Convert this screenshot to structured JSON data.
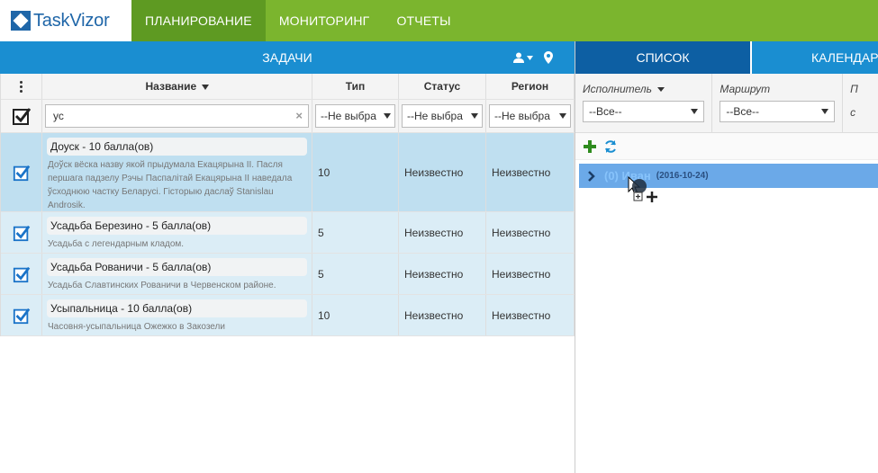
{
  "app": {
    "logo_text": "TaskVizor",
    "nav": [
      "ПЛАНИРОВАНИЕ",
      "МОНИТОРИНГ",
      "ОТЧЕТЫ"
    ],
    "active_nav": 0
  },
  "tasks_panel": {
    "title": "ЗАДАЧИ",
    "columns": [
      "Название",
      "Тип",
      "Статус",
      "Регион"
    ],
    "filter": {
      "name_value": "ус",
      "clear_symbol": "×",
      "type_select": "--Не выбра",
      "status_select": "--Не выбра",
      "region_select": "--Не выбра"
    },
    "rows": [
      {
        "name": "Доуск - 10 балла(ов)",
        "description": "Доўск вёска назву якой прыдумала Екацярына II. Пасля першага падзелу Рэчы Паспалітай Екацярына II наведала ўсходнюю частку Беларусі. Гісторыю даслаў Stanislau Androsik.",
        "type": "10",
        "status": "Неизвестно",
        "region": "Неизвестно",
        "selected": true
      },
      {
        "name": "Усадьба Березино - 5 балла(ов)",
        "description": "Усадьба с легендарным кладом.",
        "type": "5",
        "status": "Неизвестно",
        "region": "Неизвестно",
        "selected": false
      },
      {
        "name": "Усадьба Рованичи - 5 балла(ов)",
        "description": "Усадьба Славтинских Рованичи в Червенском районе.",
        "type": "5",
        "status": "Неизвестно",
        "region": "Неизвестно",
        "selected": false
      },
      {
        "name": "Усыпальница - 10 балла(ов)",
        "description": "Часовня-усыпальница Ожежко в Закозели",
        "type": "10",
        "status": "Неизвестно",
        "region": "Неизвестно",
        "selected": false
      }
    ]
  },
  "right_panel": {
    "tabs": [
      "СПИСОК",
      "КАЛЕНДАРЬ"
    ],
    "filters": {
      "executor_label": "Исполнитель",
      "executor_value": "--Все--",
      "route_label": "Маршрут",
      "route_value": "--Все--",
      "third_label": "П",
      "third_value": "с"
    },
    "group": {
      "name": "(0) Иван",
      "date": "(2016-10-24)"
    }
  },
  "colors": {
    "topbar": "#7bb52e",
    "topbar_active": "#5e9a22",
    "panel_header": "#1a8ed1",
    "tab_active": "#0d5fa3",
    "row_bg": "#dbedf6",
    "row_selected": "#bfdff0",
    "checkbox": "#1a73c8",
    "group_row": "#6ba9e8"
  },
  "icons": [
    "user-icon",
    "caret-down-icon",
    "map-pin-icon",
    "plus-icon",
    "refresh-icon",
    "chevron-right-icon",
    "checkbox-checked-icon",
    "drag-cursor-icon"
  ]
}
